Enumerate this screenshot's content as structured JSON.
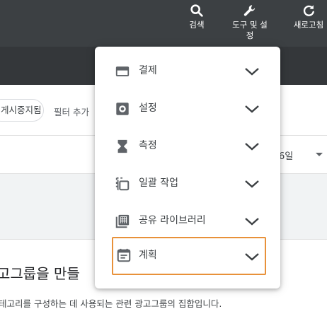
{
  "toolbar": {
    "search_label": "검색",
    "tools_label_line1": "도구 및 설",
    "tools_label_line2": "정",
    "refresh_label": "새로고침"
  },
  "filter_bar": {
    "chip_label": "게시중지됨",
    "add_filter_label": "필터 추가"
  },
  "date_range": {
    "value_partial": "6일"
  },
  "content": {
    "heading_partial": "고그룹을 만들",
    "description_partial": "테고리를 구성하는 데 사용되는 관련 광고그룹의 집합입니다."
  },
  "menu": {
    "items": [
      {
        "label": "결제",
        "icon": "credit-card-icon"
      },
      {
        "label": "설정",
        "icon": "settings-icon"
      },
      {
        "label": "측정",
        "icon": "hourglass-icon"
      },
      {
        "label": "일괄 작업",
        "icon": "bulk-copy-icon"
      },
      {
        "label": "공유 라이브러리",
        "icon": "grid-library-icon"
      },
      {
        "label": "계획",
        "icon": "calendar-icon",
        "highlighted": true
      }
    ]
  },
  "colors": {
    "toolbar_bg": "#3c4043",
    "highlight_border": "#e8913a",
    "icon_gray": "#5f6368"
  }
}
